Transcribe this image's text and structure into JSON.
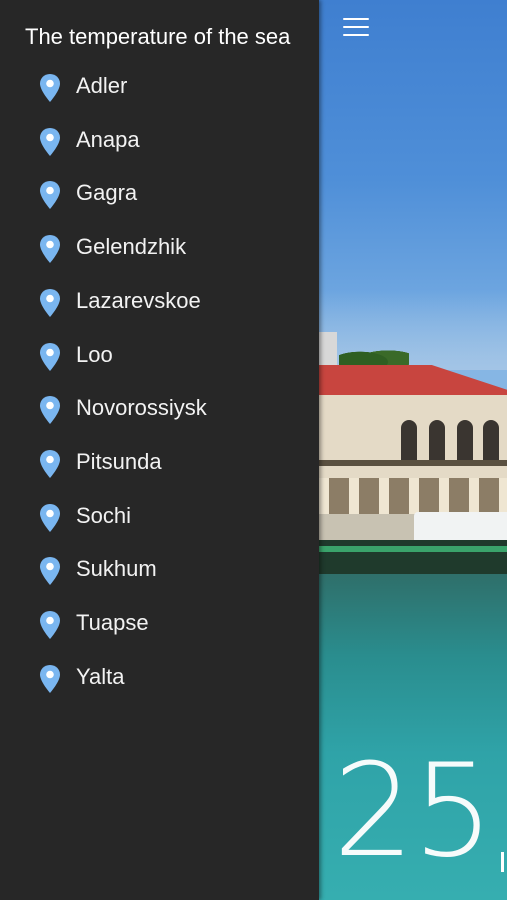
{
  "drawer": {
    "title": "The temperature of the sea",
    "cities": [
      "Adler",
      "Anapa",
      "Gagra",
      "Gelendzhik",
      "Lazarevskoe",
      "Loo",
      "Novorossiysk",
      "Pitsunda",
      "Sochi",
      "Sukhum",
      "Tuapse",
      "Yalta"
    ],
    "pin_icon": "location-pin-icon",
    "pin_color": "#7ab6f0"
  },
  "main": {
    "menu_icon": "hamburger-menu-icon",
    "temperature": "25"
  }
}
